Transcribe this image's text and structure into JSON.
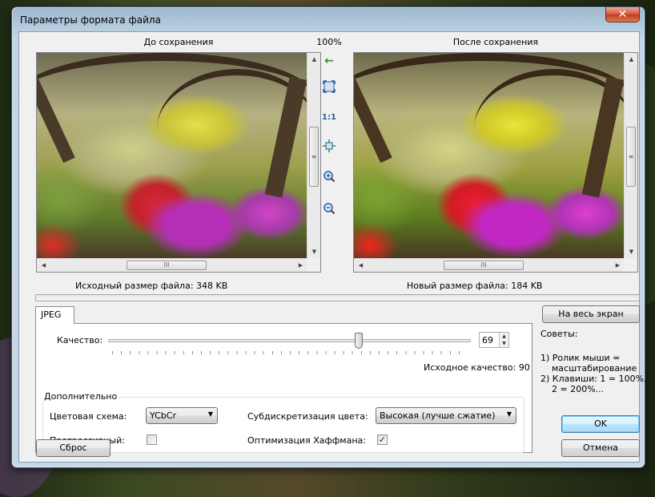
{
  "window": {
    "title": "Параметры формата файла",
    "close_symbol": "✕"
  },
  "preview": {
    "before_label": "До сохранения",
    "after_label": "После сохранения",
    "zoom_label": "100%",
    "original_size": "Исходный размер файла:  348 KB",
    "new_size": "Новый размер файла:  184 KB",
    "tools": [
      {
        "name": "back-arrow-icon",
        "glyph": "←"
      },
      {
        "name": "fit-window-icon",
        "glyph": "⛶"
      },
      {
        "name": "actual-size-label",
        "glyph": "1:1"
      },
      {
        "name": "fit-width-icon",
        "glyph": "⬌"
      },
      {
        "name": "zoom-in-icon",
        "glyph": "+"
      },
      {
        "name": "zoom-out-icon",
        "glyph": "−"
      }
    ],
    "scroll_grip": "III"
  },
  "jpeg": {
    "tab_label": "JPEG",
    "quality_label": "Качество:",
    "quality_value": "69",
    "quality_fraction": 0.69,
    "original_quality": "Исходное качество: 90",
    "group_title": "Дополнительно",
    "color_scheme_label": "Цветовая схема:",
    "color_scheme_value": "YCbCr",
    "subsampling_label": "Субдискретизация цвета:",
    "subsampling_value": "Высокая (лучше сжатие)",
    "progressive_label": "Прогрессивный:",
    "progressive_checked": false,
    "huffman_label": "Оптимизация Хаффмана:",
    "huffman_checked": true
  },
  "side": {
    "fullscreen_button": "На весь экран",
    "tips_title": "Советы:",
    "tips": [
      "1) Ролик мыши =",
      "масштабирование",
      "2) Клавиши: 1 = 100%,",
      "2 = 200%..."
    ]
  },
  "buttons": {
    "reset": "Сброс",
    "ok": "OK",
    "cancel": "Отмена"
  },
  "colors": {
    "accent": "#3c7fb1",
    "tool_green": "#2e8b3c",
    "tool_blue": "#2a5aa0"
  }
}
